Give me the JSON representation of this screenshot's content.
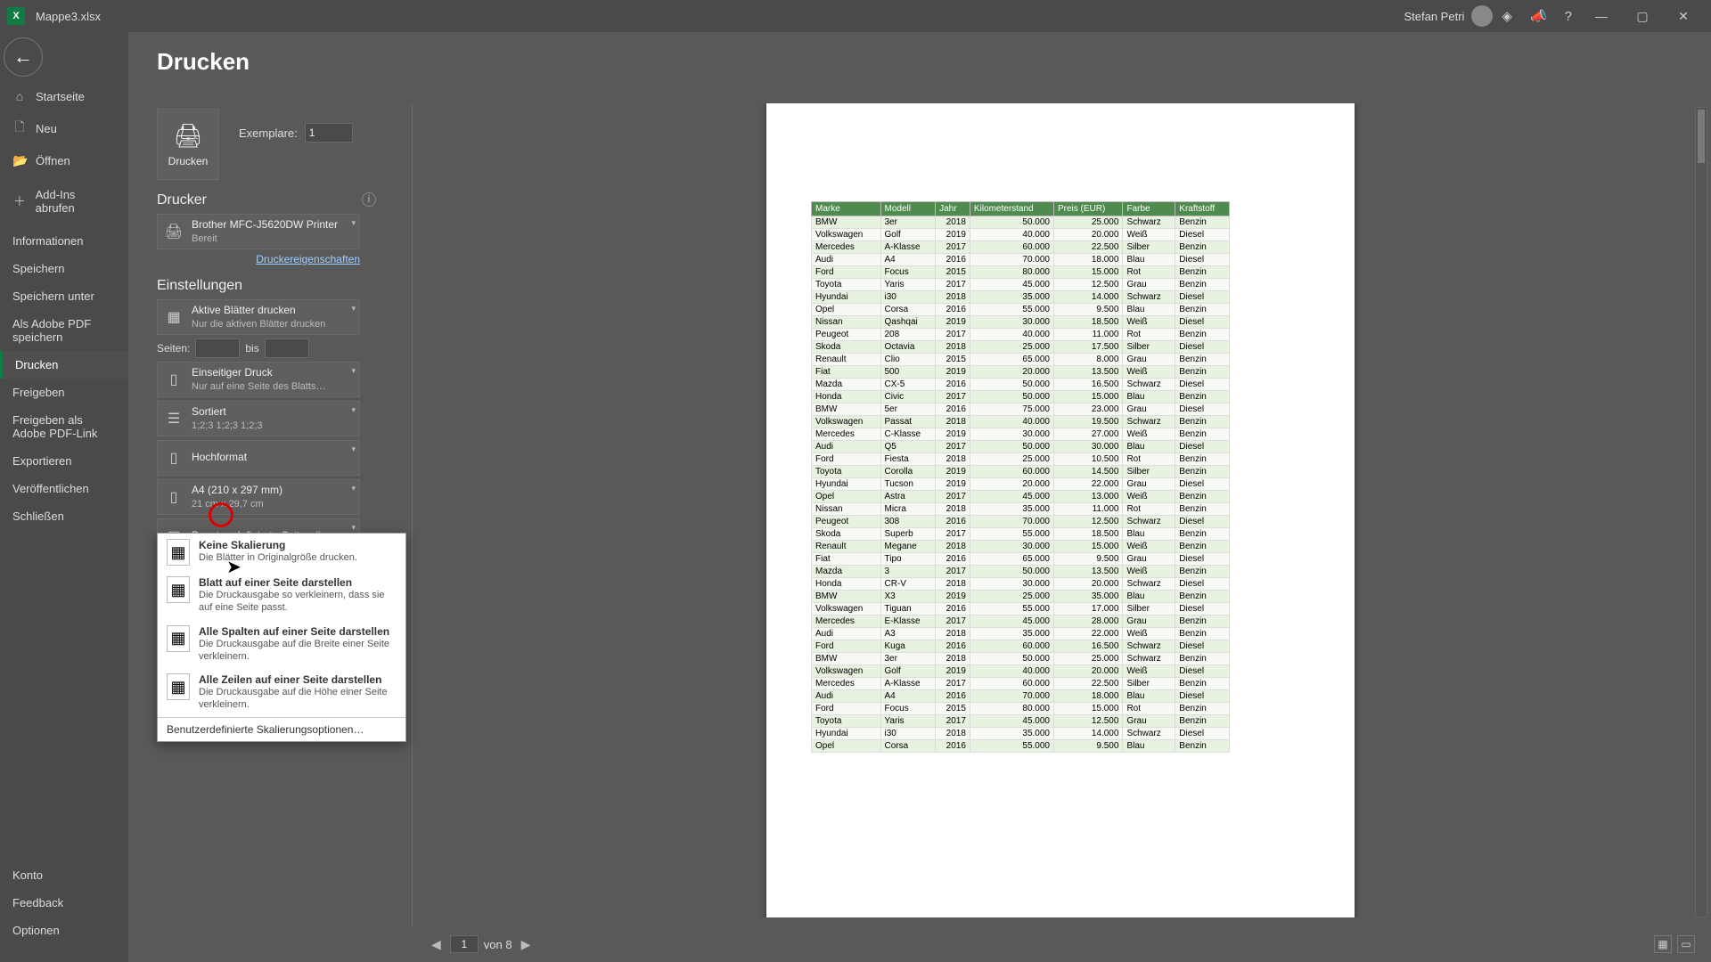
{
  "titlebar": {
    "filename": "Mappe3.xlsx",
    "username": "Stefan Petri"
  },
  "sidebar": {
    "back_aria": "Zurück",
    "items": [
      {
        "icon": "⌂",
        "label": "Startseite"
      },
      {
        "icon": "🗋",
        "label": "Neu"
      },
      {
        "icon": "📂",
        "label": "Öffnen"
      },
      {
        "icon": "＋",
        "label": "Add-Ins abrufen",
        "sep": true
      },
      {
        "icon": "",
        "label": "Informationen",
        "sep": true
      },
      {
        "icon": "",
        "label": "Speichern"
      },
      {
        "icon": "",
        "label": "Speichern unter"
      },
      {
        "icon": "",
        "label": "Als Adobe PDF speichern"
      },
      {
        "icon": "",
        "label": "Drucken",
        "active": true
      },
      {
        "icon": "",
        "label": "Freigeben"
      },
      {
        "icon": "",
        "label": "Freigeben als Adobe PDF-Link"
      },
      {
        "icon": "",
        "label": "Exportieren"
      },
      {
        "icon": "",
        "label": "Veröffentlichen"
      },
      {
        "icon": "",
        "label": "Schließen"
      }
    ],
    "bottom": [
      "Konto",
      "Feedback",
      "Optionen"
    ]
  },
  "print": {
    "page_title": "Drucken",
    "button": "Drucken",
    "copies_label": "Exemplare:",
    "copies_value": "1",
    "printer_head": "Drucker",
    "printer_name": "Brother MFC-J5620DW Printer",
    "printer_status": "Bereit",
    "printer_props": "Druckereigenschaften",
    "settings_head": "Einstellungen",
    "s_activesheets_t": "Aktive Blätter drucken",
    "s_activesheets_s": "Nur die aktiven Blätter drucken",
    "pages_label": "Seiten:",
    "pages_to": "bis",
    "s_oneside_t": "Einseitiger Druck",
    "s_oneside_s": "Nur auf eine Seite des Blatts…",
    "s_collate_t": "Sortiert",
    "s_collate_s": "1;2;3   1;2;3   1;2;3",
    "s_orient": "Hochformat",
    "s_paper_t": "A4 (210 x 297 mm)",
    "s_paper_s": "21 cm x 29,7 cm",
    "s_margins": "Benutzerdefinierte Seitenrän…",
    "s_scale_t": "Keine Skalierung",
    "s_scale_s": "Die Blätter in Originalgröße d…"
  },
  "flyout": {
    "o1_t": "Keine Skalierung",
    "o1_s": "Die Blätter in Originalgröße drucken.",
    "o2_t": "Blatt auf einer Seite darstellen",
    "o2_s": "Die Druckausgabe so verkleinern, dass sie auf eine Seite passt.",
    "o3_t": "Alle Spalten auf einer Seite darstellen",
    "o3_s": "Die Druckausgabe auf die Breite einer Seite verkleinern.",
    "o4_t": "Alle Zeilen auf einer Seite darstellen",
    "o4_s": "Die Druckausgabe auf die Höhe einer Seite verkleinern.",
    "footer": "Benutzerdefinierte Skalierungsoptionen…"
  },
  "pager": {
    "current": "1",
    "of_label": "von 8"
  },
  "table": {
    "headers": [
      "Marke",
      "Modell",
      "Jahr",
      "Kilometerstand",
      "Preis (EUR)",
      "Farbe",
      "Kraftstoff"
    ],
    "rows": [
      [
        "BMW",
        "3er",
        "2018",
        "50.000",
        "25.000",
        "Schwarz",
        "Benzin"
      ],
      [
        "Volkswagen",
        "Golf",
        "2019",
        "40.000",
        "20.000",
        "Weiß",
        "Diesel"
      ],
      [
        "Mercedes",
        "A-Klasse",
        "2017",
        "60.000",
        "22.500",
        "Silber",
        "Benzin"
      ],
      [
        "Audi",
        "A4",
        "2016",
        "70.000",
        "18.000",
        "Blau",
        "Diesel"
      ],
      [
        "Ford",
        "Focus",
        "2015",
        "80.000",
        "15.000",
        "Rot",
        "Benzin"
      ],
      [
        "Toyota",
        "Yaris",
        "2017",
        "45.000",
        "12.500",
        "Grau",
        "Benzin"
      ],
      [
        "Hyundai",
        "i30",
        "2018",
        "35.000",
        "14.000",
        "Schwarz",
        "Diesel"
      ],
      [
        "Opel",
        "Corsa",
        "2016",
        "55.000",
        "9.500",
        "Blau",
        "Benzin"
      ],
      [
        "Nissan",
        "Qashqai",
        "2019",
        "30.000",
        "18.500",
        "Weiß",
        "Diesel"
      ],
      [
        "Peugeot",
        "208",
        "2017",
        "40.000",
        "11.000",
        "Rot",
        "Benzin"
      ],
      [
        "Skoda",
        "Octavia",
        "2018",
        "25.000",
        "17.500",
        "Silber",
        "Diesel"
      ],
      [
        "Renault",
        "Clio",
        "2015",
        "65.000",
        "8.000",
        "Grau",
        "Benzin"
      ],
      [
        "Fiat",
        "500",
        "2019",
        "20.000",
        "13.500",
        "Weiß",
        "Benzin"
      ],
      [
        "Mazda",
        "CX-5",
        "2016",
        "50.000",
        "16.500",
        "Schwarz",
        "Diesel"
      ],
      [
        "Honda",
        "Civic",
        "2017",
        "50.000",
        "15.000",
        "Blau",
        "Benzin"
      ],
      [
        "BMW",
        "5er",
        "2016",
        "75.000",
        "23.000",
        "Grau",
        "Diesel"
      ],
      [
        "Volkswagen",
        "Passat",
        "2018",
        "40.000",
        "19.500",
        "Schwarz",
        "Benzin"
      ],
      [
        "Mercedes",
        "C-Klasse",
        "2019",
        "30.000",
        "27.000",
        "Weiß",
        "Benzin"
      ],
      [
        "Audi",
        "Q5",
        "2017",
        "50.000",
        "30.000",
        "Blau",
        "Diesel"
      ],
      [
        "Ford",
        "Fiesta",
        "2018",
        "25.000",
        "10.500",
        "Rot",
        "Benzin"
      ],
      [
        "Toyota",
        "Corolla",
        "2019",
        "60.000",
        "14.500",
        "Silber",
        "Benzin"
      ],
      [
        "Hyundai",
        "Tucson",
        "2019",
        "20.000",
        "22.000",
        "Grau",
        "Diesel"
      ],
      [
        "Opel",
        "Astra",
        "2017",
        "45.000",
        "13.000",
        "Weiß",
        "Benzin"
      ],
      [
        "Nissan",
        "Micra",
        "2018",
        "35.000",
        "11.000",
        "Rot",
        "Benzin"
      ],
      [
        "Peugeot",
        "308",
        "2016",
        "70.000",
        "12.500",
        "Schwarz",
        "Diesel"
      ],
      [
        "Skoda",
        "Superb",
        "2017",
        "55.000",
        "18.500",
        "Blau",
        "Benzin"
      ],
      [
        "Renault",
        "Megane",
        "2018",
        "30.000",
        "15.000",
        "Weiß",
        "Benzin"
      ],
      [
        "Fiat",
        "Tipo",
        "2016",
        "65.000",
        "9.500",
        "Grau",
        "Diesel"
      ],
      [
        "Mazda",
        "3",
        "2017",
        "50.000",
        "13.500",
        "Weiß",
        "Benzin"
      ],
      [
        "Honda",
        "CR-V",
        "2018",
        "30.000",
        "20.000",
        "Schwarz",
        "Diesel"
      ],
      [
        "BMW",
        "X3",
        "2019",
        "25.000",
        "35.000",
        "Blau",
        "Benzin"
      ],
      [
        "Volkswagen",
        "Tiguan",
        "2016",
        "55.000",
        "17.000",
        "Silber",
        "Diesel"
      ],
      [
        "Mercedes",
        "E-Klasse",
        "2017",
        "45.000",
        "28.000",
        "Grau",
        "Benzin"
      ],
      [
        "Audi",
        "A3",
        "2018",
        "35.000",
        "22.000",
        "Weiß",
        "Benzin"
      ],
      [
        "Ford",
        "Kuga",
        "2016",
        "60.000",
        "16.500",
        "Schwarz",
        "Diesel"
      ],
      [
        "BMW",
        "3er",
        "2018",
        "50.000",
        "25.000",
        "Schwarz",
        "Benzin"
      ],
      [
        "Volkswagen",
        "Golf",
        "2019",
        "40.000",
        "20.000",
        "Weiß",
        "Diesel"
      ],
      [
        "Mercedes",
        "A-Klasse",
        "2017",
        "60.000",
        "22.500",
        "Silber",
        "Benzin"
      ],
      [
        "Audi",
        "A4",
        "2016",
        "70.000",
        "18.000",
        "Blau",
        "Diesel"
      ],
      [
        "Ford",
        "Focus",
        "2015",
        "80.000",
        "15.000",
        "Rot",
        "Benzin"
      ],
      [
        "Toyota",
        "Yaris",
        "2017",
        "45.000",
        "12.500",
        "Grau",
        "Benzin"
      ],
      [
        "Hyundai",
        "i30",
        "2018",
        "35.000",
        "14.000",
        "Schwarz",
        "Diesel"
      ],
      [
        "Opel",
        "Corsa",
        "2016",
        "55.000",
        "9.500",
        "Blau",
        "Benzin"
      ]
    ]
  }
}
